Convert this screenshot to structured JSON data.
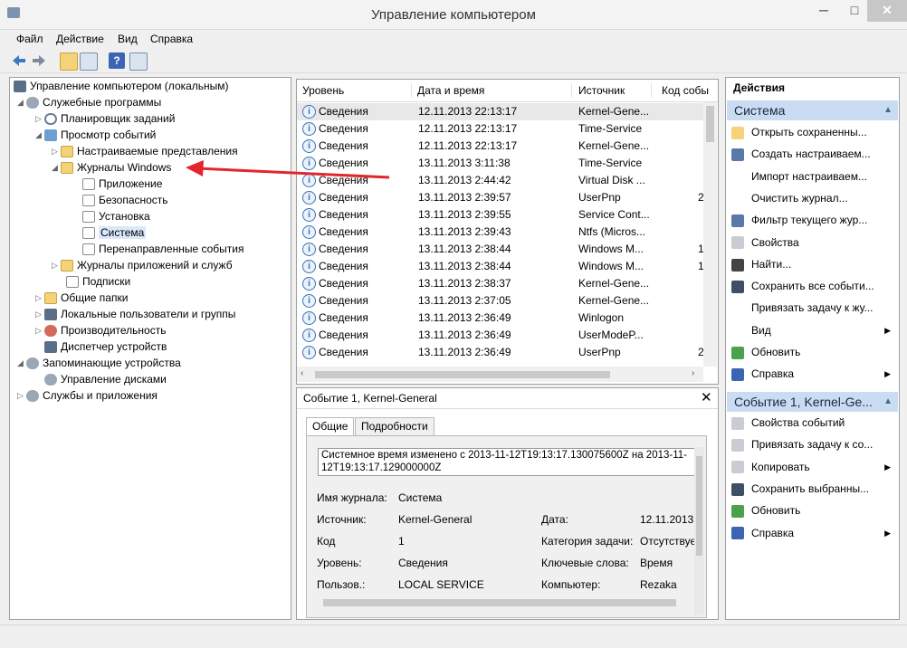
{
  "window": {
    "title": "Управление компьютером",
    "minimize": "─",
    "maximize": "□",
    "close": "✕"
  },
  "menu": [
    "Файл",
    "Действие",
    "Вид",
    "Справка"
  ],
  "toolbar": {
    "icons": [
      "back-arrow-icon",
      "forward-arrow-icon",
      "up-folder-icon",
      "console-tree-icon",
      "help-icon",
      "action-pane-icon"
    ]
  },
  "tree": {
    "items": [
      {
        "label": "Управление компьютером (локальным)",
        "icon": "computer-mgmt-icon"
      },
      {
        "label": "Служебные программы",
        "icon": "tools-icon"
      },
      {
        "label": "Планировщик заданий",
        "icon": "clock-icon"
      },
      {
        "label": "Просмотр событий",
        "icon": "event-viewer-icon"
      },
      {
        "label": "Настраиваемые представления",
        "icon": "folder-icon"
      },
      {
        "label": "Журналы Windows",
        "icon": "folder-icon"
      },
      {
        "label": "Приложение",
        "icon": "log-icon"
      },
      {
        "label": "Безопасность",
        "icon": "log-icon"
      },
      {
        "label": "Установка",
        "icon": "log-icon"
      },
      {
        "label": "Система",
        "icon": "log-icon"
      },
      {
        "label": "Перенаправленные события",
        "icon": "log-icon"
      },
      {
        "label": "Журналы приложений и служб",
        "icon": "folder-icon"
      },
      {
        "label": "Подписки",
        "icon": "doc-icon"
      },
      {
        "label": "Общие папки",
        "icon": "shared-folder-icon"
      },
      {
        "label": "Локальные пользователи и группы",
        "icon": "users-icon"
      },
      {
        "label": "Производительность",
        "icon": "performance-icon"
      },
      {
        "label": "Диспетчер устройств",
        "icon": "device-manager-icon"
      },
      {
        "label": "Запоминающие устройства",
        "icon": "storage-icon"
      },
      {
        "label": "Управление дисками",
        "icon": "disk-icon"
      },
      {
        "label": "Службы и приложения",
        "icon": "services-icon"
      }
    ]
  },
  "events": {
    "columns": [
      "Уровень",
      "Дата и время",
      "Источник",
      "Код собы"
    ],
    "rows": [
      {
        "level": "Сведения",
        "date": "12.11.2013 22:13:17",
        "source": "Kernel-Gene...",
        "code": ""
      },
      {
        "level": "Сведения",
        "date": "12.11.2013 22:13:17",
        "source": "Time-Service",
        "code": ""
      },
      {
        "level": "Сведения",
        "date": "12.11.2013 22:13:17",
        "source": "Kernel-Gene...",
        "code": ""
      },
      {
        "level": "Сведения",
        "date": "13.11.2013 3:11:38",
        "source": "Time-Service",
        "code": ""
      },
      {
        "level": "Сведения",
        "date": "13.11.2013 2:44:42",
        "source": "Virtual Disk ...",
        "code": ""
      },
      {
        "level": "Сведения",
        "date": "13.11.2013 2:39:57",
        "source": "UserPnp",
        "code": "2"
      },
      {
        "level": "Сведения",
        "date": "13.11.2013 2:39:55",
        "source": "Service Cont...",
        "code": ""
      },
      {
        "level": "Сведения",
        "date": "13.11.2013 2:39:43",
        "source": "Ntfs (Micros...",
        "code": ""
      },
      {
        "level": "Сведения",
        "date": "13.11.2013 2:38:44",
        "source": "Windows M...",
        "code": "1"
      },
      {
        "level": "Сведения",
        "date": "13.11.2013 2:38:44",
        "source": "Windows M...",
        "code": "1"
      },
      {
        "level": "Сведения",
        "date": "13.11.2013 2:38:37",
        "source": "Kernel-Gene...",
        "code": ""
      },
      {
        "level": "Сведения",
        "date": "13.11.2013 2:37:05",
        "source": "Kernel-Gene...",
        "code": ""
      },
      {
        "level": "Сведения",
        "date": "13.11.2013 2:36:49",
        "source": "Winlogon",
        "code": ""
      },
      {
        "level": "Сведения",
        "date": "13.11.2013 2:36:49",
        "source": "UserModeP...",
        "code": ""
      },
      {
        "level": "Сведения",
        "date": "13.11.2013 2:36:49",
        "source": "UserPnp",
        "code": "2"
      }
    ]
  },
  "detail": {
    "title": "Событие 1, Kernel-General",
    "tabs": [
      "Общие",
      "Подробности"
    ],
    "message_line1": "Системное время изменено с 2013-11-12T19:13:17.130075600Z на 2013-11-",
    "message_line2": "12T19:13:17.129000000Z",
    "labels": {
      "log_name": "Имя журнала:",
      "source": "Источник:",
      "code": "Код",
      "level": "Уровень:",
      "user": "Пользов.:",
      "date": "Дата:",
      "category": "Категория задачи:",
      "keywords": "Ключевые слова:",
      "computer": "Компьютер:"
    },
    "values": {
      "log_name": "Система",
      "source": "Kernel-General",
      "code": "1",
      "level": "Сведения",
      "user": "LOCAL SERVICE",
      "date": "12.11.2013 2",
      "category": "Отсутствуе",
      "keywords": "Время",
      "computer": "Rezaka"
    }
  },
  "actions": {
    "header": "Действия",
    "section1": "Система",
    "items1": [
      {
        "label": "Открыть сохраненны...",
        "icon": "open-folder-icon",
        "submenu": false
      },
      {
        "label": "Создать настраиваем...",
        "icon": "filter-icon",
        "submenu": false
      },
      {
        "label": "Импорт настраиваем...",
        "icon": "",
        "submenu": false
      },
      {
        "label": "Очистить журнал...",
        "icon": "",
        "submenu": false
      },
      {
        "label": "Фильтр текущего жур...",
        "icon": "filter-icon",
        "submenu": false
      },
      {
        "label": "Свойства",
        "icon": "properties-icon",
        "submenu": false
      },
      {
        "label": "Найти...",
        "icon": "binoculars-icon",
        "submenu": false
      },
      {
        "label": "Сохранить все событи...",
        "icon": "save-icon",
        "submenu": false
      },
      {
        "label": "Привязать задачу к жу...",
        "icon": "",
        "submenu": false
      },
      {
        "label": "Вид",
        "icon": "",
        "submenu": true
      },
      {
        "label": "Обновить",
        "icon": "refresh-icon",
        "submenu": false
      },
      {
        "label": "Справка",
        "icon": "help-icon",
        "submenu": true
      }
    ],
    "section2": "Событие 1, Kernel-Ge...",
    "items2": [
      {
        "label": "Свойства событий",
        "icon": "event-properties-icon",
        "submenu": false
      },
      {
        "label": "Привязать задачу к со...",
        "icon": "task-icon",
        "submenu": false
      },
      {
        "label": "Копировать",
        "icon": "copy-icon",
        "submenu": true
      },
      {
        "label": "Сохранить выбранны...",
        "icon": "save-icon",
        "submenu": false
      },
      {
        "label": "Обновить",
        "icon": "refresh-icon",
        "submenu": false
      },
      {
        "label": "Справка",
        "icon": "help-icon",
        "submenu": true
      }
    ]
  },
  "colors": {
    "accent": "#c9dcf2",
    "annotation_arrow": "#e3262b",
    "info_icon": "#3b6fb3"
  }
}
